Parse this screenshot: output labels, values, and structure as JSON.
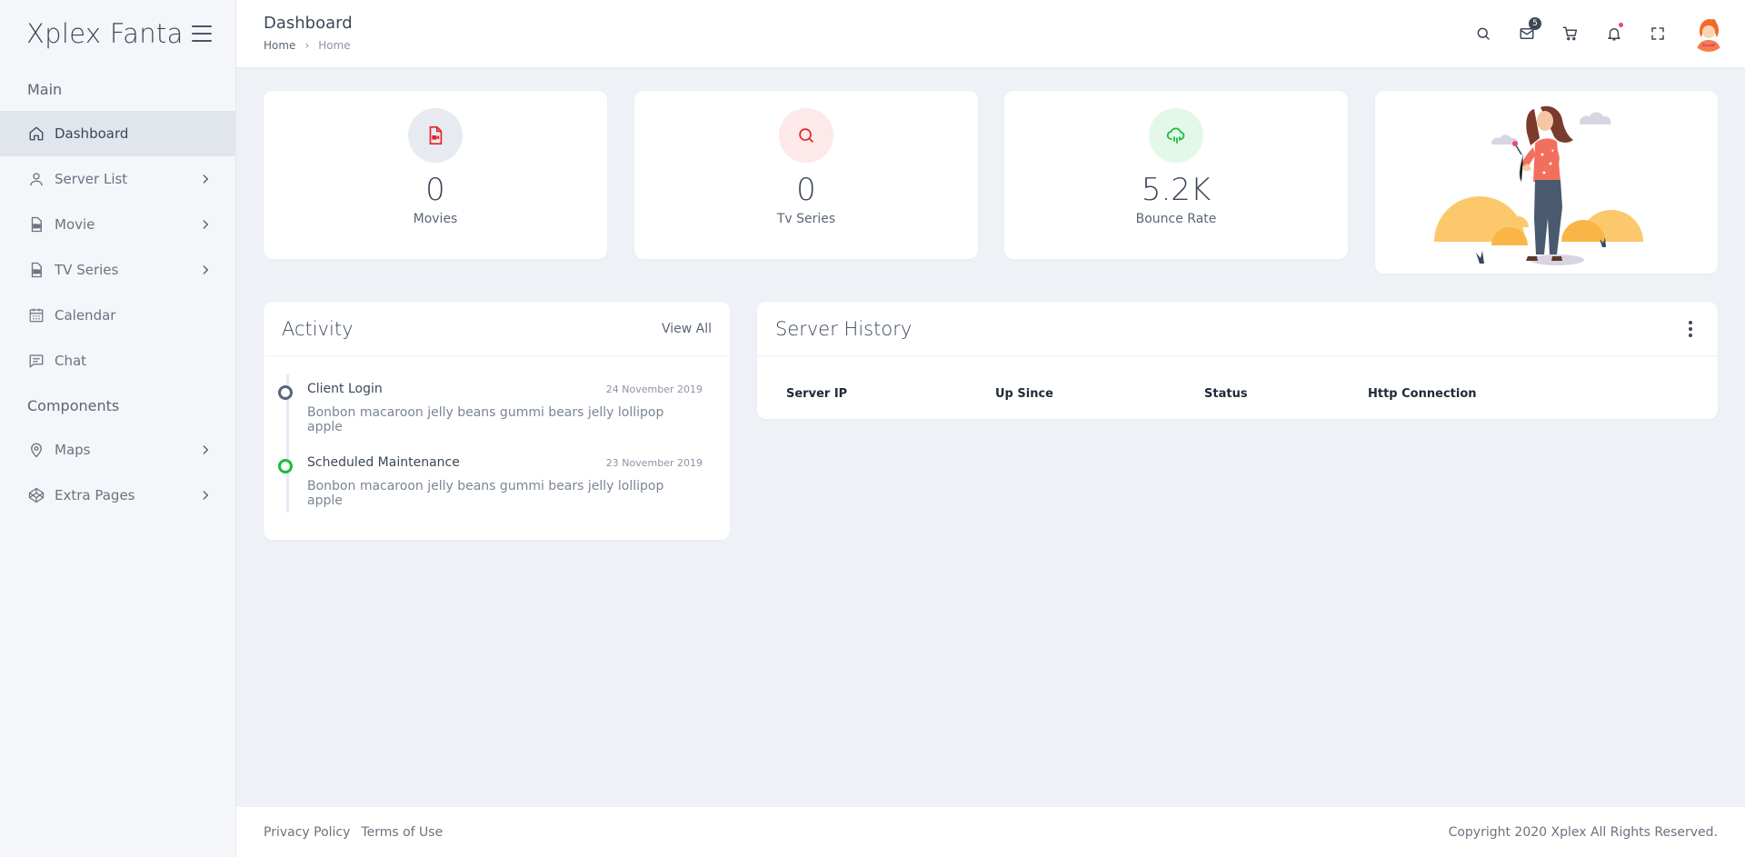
{
  "brand": {
    "name": "Xplex Fanta"
  },
  "sidebar": {
    "header_main": "Main",
    "header_components": "Components",
    "items": [
      {
        "label": "Dashboard",
        "icon": "home-icon",
        "active": true
      },
      {
        "label": "Server List",
        "icon": "user-icon",
        "has_children": true
      },
      {
        "label": "Movie",
        "icon": "video-file-icon",
        "has_children": true
      },
      {
        "label": "TV Series",
        "icon": "video-file-icon",
        "has_children": true
      },
      {
        "label": "Calendar",
        "icon": "calendar-icon"
      },
      {
        "label": "Chat",
        "icon": "chat-icon"
      },
      {
        "label": "Maps",
        "icon": "map-pin-icon",
        "has_children": true
      },
      {
        "label": "Extra Pages",
        "icon": "codepen-icon",
        "has_children": true
      }
    ]
  },
  "header": {
    "title": "Dashboard",
    "breadcrumb": [
      "Home",
      "Home"
    ],
    "mail_count": "5",
    "icons": [
      "search-icon",
      "mail-icon",
      "cart-icon",
      "bell-icon",
      "fullscreen-icon"
    ]
  },
  "stats": [
    {
      "value": "0",
      "label": "Movies",
      "icon": "video-file-icon",
      "bg": "#e7eaf0",
      "color": "#e02424"
    },
    {
      "value": "0",
      "label": "Tv Series",
      "icon": "search-icon",
      "bg": "#fde8ea",
      "color": "#e02424"
    },
    {
      "value": "5.2K",
      "label": "Bounce Rate",
      "icon": "cloud-rain-icon",
      "bg": "#e3f8e8",
      "color": "#1bbc3b"
    }
  ],
  "activity": {
    "title": "Activity",
    "view_all": "View All",
    "items": [
      {
        "title": "Client Login",
        "date": "24 November 2019",
        "desc": "Bonbon macaroon jelly beans gummi bears jelly lollipop apple",
        "status_color": "#5a6577"
      },
      {
        "title": "Scheduled Maintenance",
        "date": "23 November 2019",
        "desc": "Bonbon macaroon jelly beans gummi bears jelly lollipop apple",
        "status_color": "#1bbc3b"
      }
    ]
  },
  "server_history": {
    "title": "Server History",
    "columns": [
      "Server IP",
      "Up Since",
      "Status",
      "Http Connection"
    ]
  },
  "footer": {
    "privacy": "Privacy Policy",
    "terms": "Terms of Use",
    "copyright": "Copyright 2020 Xplex All Rights Reserved."
  }
}
